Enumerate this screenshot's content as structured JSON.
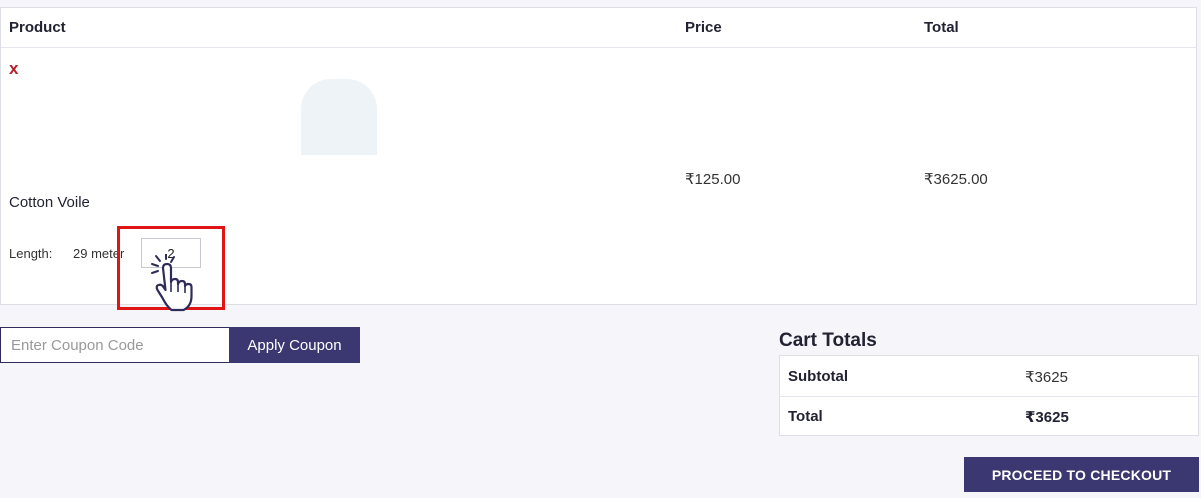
{
  "cart_table": {
    "headers": {
      "product": "Product",
      "price": "Price",
      "total": "Total"
    },
    "item": {
      "remove_label": "x",
      "name": "Cotton Voile",
      "length_label": "Length:",
      "length_value": "29 meter",
      "quantity": "2",
      "price": "₹125.00",
      "total": "₹3625.00"
    }
  },
  "coupon": {
    "placeholder": "Enter Coupon Code",
    "button_label": "Apply Coupon"
  },
  "cart_totals": {
    "title": "Cart Totals",
    "rows": [
      {
        "label": "Subtotal",
        "value": "₹3625"
      },
      {
        "label": "Total",
        "value": "₹3625"
      }
    ]
  },
  "checkout_button": "PROCEED TO CHECKOUT",
  "colors": {
    "accent": "#3b3770",
    "remove": "#b3212a",
    "highlight": "#e01414",
    "background": "#f5f5fa"
  },
  "icons": [
    "hand-pointer-icon"
  ]
}
